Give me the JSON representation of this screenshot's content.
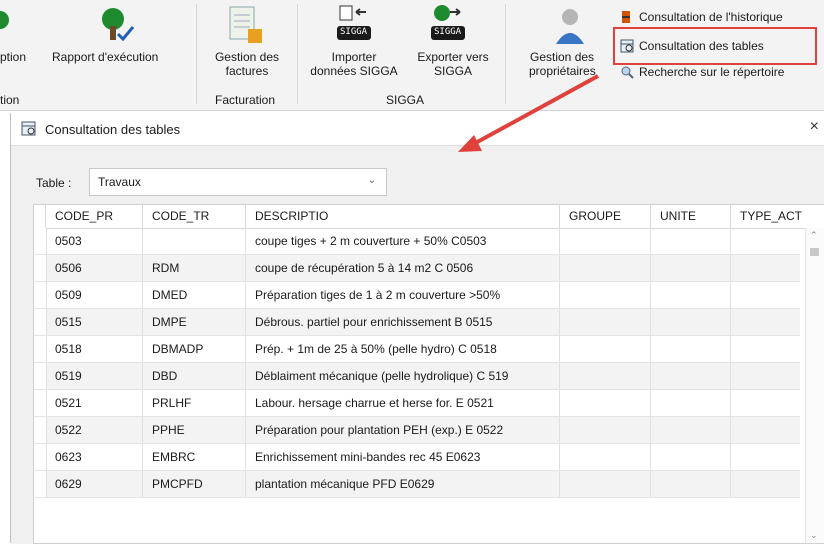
{
  "ribbon": {
    "buttons": [
      {
        "label": "ption"
      },
      {
        "label": "Rapport d'exécution"
      },
      {
        "label1": "Gestion des",
        "label2": "factures"
      },
      {
        "label1": "Importer",
        "label2": "données SIGGA",
        "tag": "SIGGA"
      },
      {
        "label1": "Exporter vers",
        "label2": "SIGGA",
        "tag": "SIGGA"
      },
      {
        "label1": "Gestion des",
        "label2": "propriétaires"
      }
    ],
    "groups": {
      "left": "tion",
      "facturation": "Facturation",
      "sigga": "SIGGA"
    },
    "small_items": [
      {
        "label": "Consultation de l'historique",
        "icon": "history-icon"
      },
      {
        "label": "Consultation des tables",
        "icon": "table-icon"
      },
      {
        "label": "Recherche sur le répertoire",
        "icon": "search-icon"
      }
    ]
  },
  "dialog": {
    "title": "Consultation des tables",
    "close": "×",
    "table_label": "Table :",
    "table_value": "Travaux"
  },
  "grid": {
    "columns": [
      "CODE_PR",
      "CODE_TR",
      "DESCRIPTIO",
      "GROUPE",
      "UNITE",
      "TYPE_ACT"
    ],
    "rows": [
      [
        "0503",
        "",
        "coupe tiges + 2 m couverture + 50% C0503",
        "",
        "",
        ""
      ],
      [
        "0506",
        "RDM",
        "coupe de récupération 5 à 14 m2   C 0506",
        "",
        "",
        ""
      ],
      [
        "0509",
        "DMED",
        "Préparation tiges de 1 à 2 m couverture >50%",
        "",
        "",
        ""
      ],
      [
        "0515",
        "DMPE",
        "Débrous. partiel pour enrichissement   B 0515",
        "",
        "",
        ""
      ],
      [
        "0518",
        "DBMADP",
        "Prép. + 1m de 25 à 50% (pelle hydro)  C 0518",
        "",
        "",
        ""
      ],
      [
        "0519",
        "DBD",
        "Déblaiment mécanique (pelle hydrolique) C 519",
        "",
        "",
        ""
      ],
      [
        "0521",
        "PRLHF",
        "Labour. hersage charrue et herse for.  E 0521",
        "",
        "",
        ""
      ],
      [
        "0522",
        "PPHE",
        "Préparation pour plantation PEH (exp.) E 0522",
        "",
        "",
        ""
      ],
      [
        "0623",
        "EMBRC",
        "Enrichissement mini-bandes rec 45 E0623",
        "",
        "",
        ""
      ],
      [
        "0629",
        "PMCPFD",
        "plantation mécanique PFD  E0629",
        "",
        "",
        ""
      ]
    ]
  },
  "colors": {
    "highlight": "#e0413a",
    "arrow": "#e0413a",
    "tree": "#1e8a2e"
  }
}
